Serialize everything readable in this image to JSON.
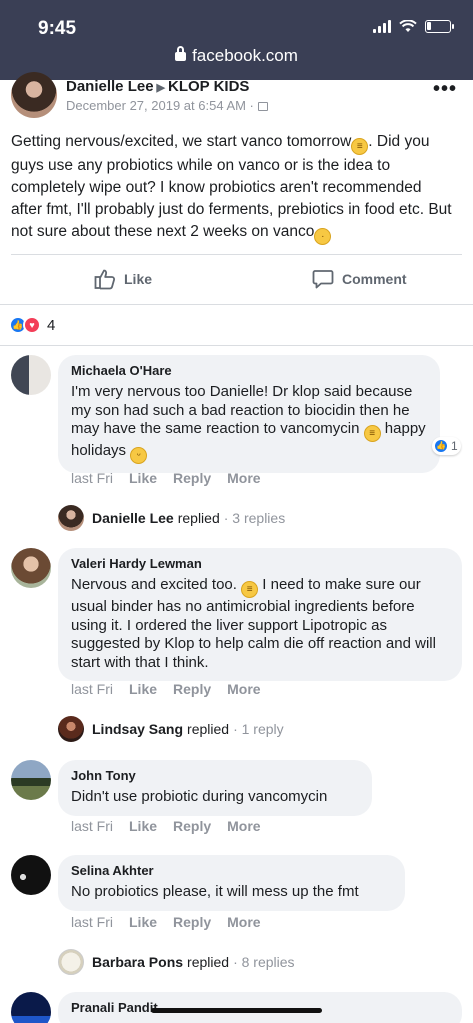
{
  "status_bar": {
    "time": "9:45",
    "url": "facebook.com"
  },
  "post": {
    "author": "Danielle Lee",
    "group": "KLOP KIDS",
    "date": "December 27, 2019 at 6:54 AM · ",
    "text_1": "Getting nervous/excited, we start vanco tomorrow",
    "text_2": ". Did you guys use any probiotics while on vanco or is the idea to completely wipe out? I know probiotics aren't recommended after fmt, I'll probably just do ferments, prebiotics in food etc. But not sure about these next 2 weeks on vanco",
    "like_label": "Like",
    "comment_label": "Comment",
    "reaction_count": "4"
  },
  "comments": [
    {
      "name": "Michaela O'Hare",
      "text_1": "I'm very nervous too Danielle! Dr klop said because my son had such a bad reaction to biocidin then he may have the same reaction to vancomycin ",
      "text_2": " happy holidays ",
      "time": "last Fri",
      "like": "Like",
      "reply": "Reply",
      "more": "More",
      "reaction_count": "1",
      "replier": "Danielle Lee",
      "replied": "replied",
      "replies": "· 3 replies"
    },
    {
      "name": "Valeri Hardy Lewman",
      "text_1": "Nervous and excited too. ",
      "text_2": " I need to make sure our usual binder has no antimicrobial ingredients before using it. I ordered the liver support Lipotropic as suggested by Klop to help calm die off reaction and will start with that I think.",
      "time": "last Fri",
      "like": "Like",
      "reply": "Reply",
      "more": "More",
      "replier": "Lindsay Sang",
      "replied": "replied",
      "replies": "· 1 reply"
    },
    {
      "name": "John Tony",
      "text": "Didn't use probiotic during vancomycin",
      "time": "last Fri",
      "like": "Like",
      "reply": "Reply",
      "more": "More"
    },
    {
      "name": "Selina Akhter",
      "text": "No probiotics please, it will mess up the fmt",
      "time": "last Fri",
      "like": "Like",
      "reply": "Reply",
      "more": "More",
      "replier": "Barbara Pons",
      "replied": "replied",
      "replies": "· 8 replies"
    },
    {
      "name": "Pranali Pandit"
    }
  ],
  "colors": {
    "browser_bar": "#3a3f55",
    "facebook_blue": "#1877f2",
    "bubble_bg": "#f0f2f5",
    "meta_gray": "#90949c"
  }
}
